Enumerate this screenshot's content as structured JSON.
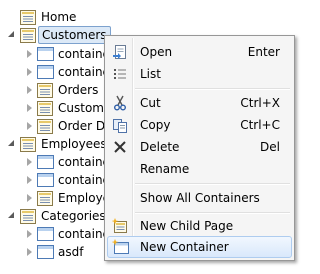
{
  "tree": {
    "home": "Home",
    "customers": "Customers",
    "customers_children": [
      "containe",
      "containe",
      "Orders",
      "Custome",
      "Order De"
    ],
    "employees": "Employees",
    "employees_children": [
      "containe",
      "containe",
      "Employe"
    ],
    "categories": "Categories",
    "categories_children": [
      "containe",
      "asdf"
    ]
  },
  "menu": {
    "open": {
      "label": "Open",
      "shortcut": "Enter"
    },
    "list": {
      "label": "List"
    },
    "cut": {
      "label": "Cut",
      "shortcut": "Ctrl+X"
    },
    "copy": {
      "label": "Copy",
      "shortcut": "Ctrl+C"
    },
    "delete": {
      "label": "Delete",
      "shortcut": "Del"
    },
    "rename": {
      "label": "Rename"
    },
    "show_all": {
      "label": "Show All Containers"
    },
    "new_child_page": {
      "label": "New Child Page"
    },
    "new_container": {
      "label": "New Container"
    }
  },
  "colors": {
    "selection_fill": "#dce9f7",
    "selection_border": "#7da2ce",
    "menu_hover_border": "#aeccef"
  }
}
